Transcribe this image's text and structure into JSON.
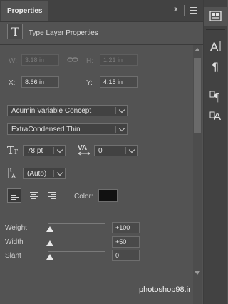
{
  "panel": {
    "tab_label": "Properties",
    "tab_close": "×",
    "collapse_glyph": "››",
    "section_title": "Type Layer Properties",
    "type_icon_glyph": "T"
  },
  "transform": {
    "w_label": "W:",
    "w_value": "3.18 in",
    "h_label": "H:",
    "h_value": "1.21 in",
    "x_label": "X:",
    "x_value": "8.66 in",
    "y_label": "Y:",
    "y_value": "4.15 in"
  },
  "character": {
    "font_family": "Acumin Variable Concept",
    "font_style": "ExtraCondensed Thin",
    "font_size": "78 pt",
    "tracking": "0",
    "leading": "(Auto)",
    "color_label": "Color:",
    "color_swatch": "#111111"
  },
  "variable_axes": [
    {
      "label": "Weight",
      "value": "+100",
      "fraction": 0.0
    },
    {
      "label": "Width",
      "value": "+50",
      "fraction": 0.0
    },
    {
      "label": "Slant",
      "value": "0",
      "fraction": 0.0
    }
  ],
  "watermark": "photoshop98.ir",
  "dock": {
    "items": [
      "properties-panel-icon",
      "character-panel-icon",
      "paragraph-panel-icon",
      "paragraph-styles-icon",
      "character-styles-icon"
    ]
  }
}
